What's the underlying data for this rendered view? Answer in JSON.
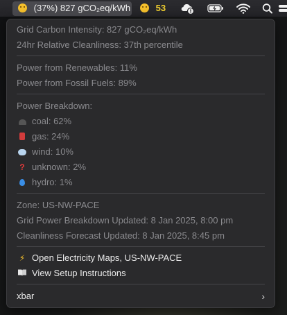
{
  "menubar": {
    "carbon_title": "(37%) 827 gCO₂eq/kWh",
    "count": "53",
    "icons": [
      "worried-face-icon",
      "smiley-face-icon",
      "cloud-alert-icon",
      "battery-charging-icon",
      "wifi-icon",
      "search-icon",
      "control-center-icon"
    ]
  },
  "menu": {
    "intensity": "Grid Carbon Intensity: 827 gCO₂eq/kWh",
    "cleanliness": "24hr Relative Cleanliness: 37th percentile",
    "renewables": "Power from Renewables: 11%",
    "fossil": "Power from Fossil Fuels: 89%",
    "breakdown_header": "Power Breakdown:",
    "sources": [
      {
        "label": "coal: 62%",
        "icon": "coal-icon"
      },
      {
        "label": "gas: 24%",
        "icon": "gas-can-icon"
      },
      {
        "label": "wind: 10%",
        "icon": "wind-icon"
      },
      {
        "label": "unknown: 2%",
        "icon": "question-mark-icon"
      },
      {
        "label": "hydro: 1%",
        "icon": "droplet-icon"
      }
    ],
    "zone": "Zone: US-NW-PACE",
    "breakdown_updated": "Grid Power Breakdown Updated: 8 Jan 2025, 8:00 pm",
    "forecast_updated": "Cleanliness Forecast Updated: 8 Jan 2025, 8:45 pm",
    "open_maps": "Open Electricity Maps, US-NW-PACE",
    "setup": "View Setup Instructions",
    "xbar": "xbar"
  }
}
